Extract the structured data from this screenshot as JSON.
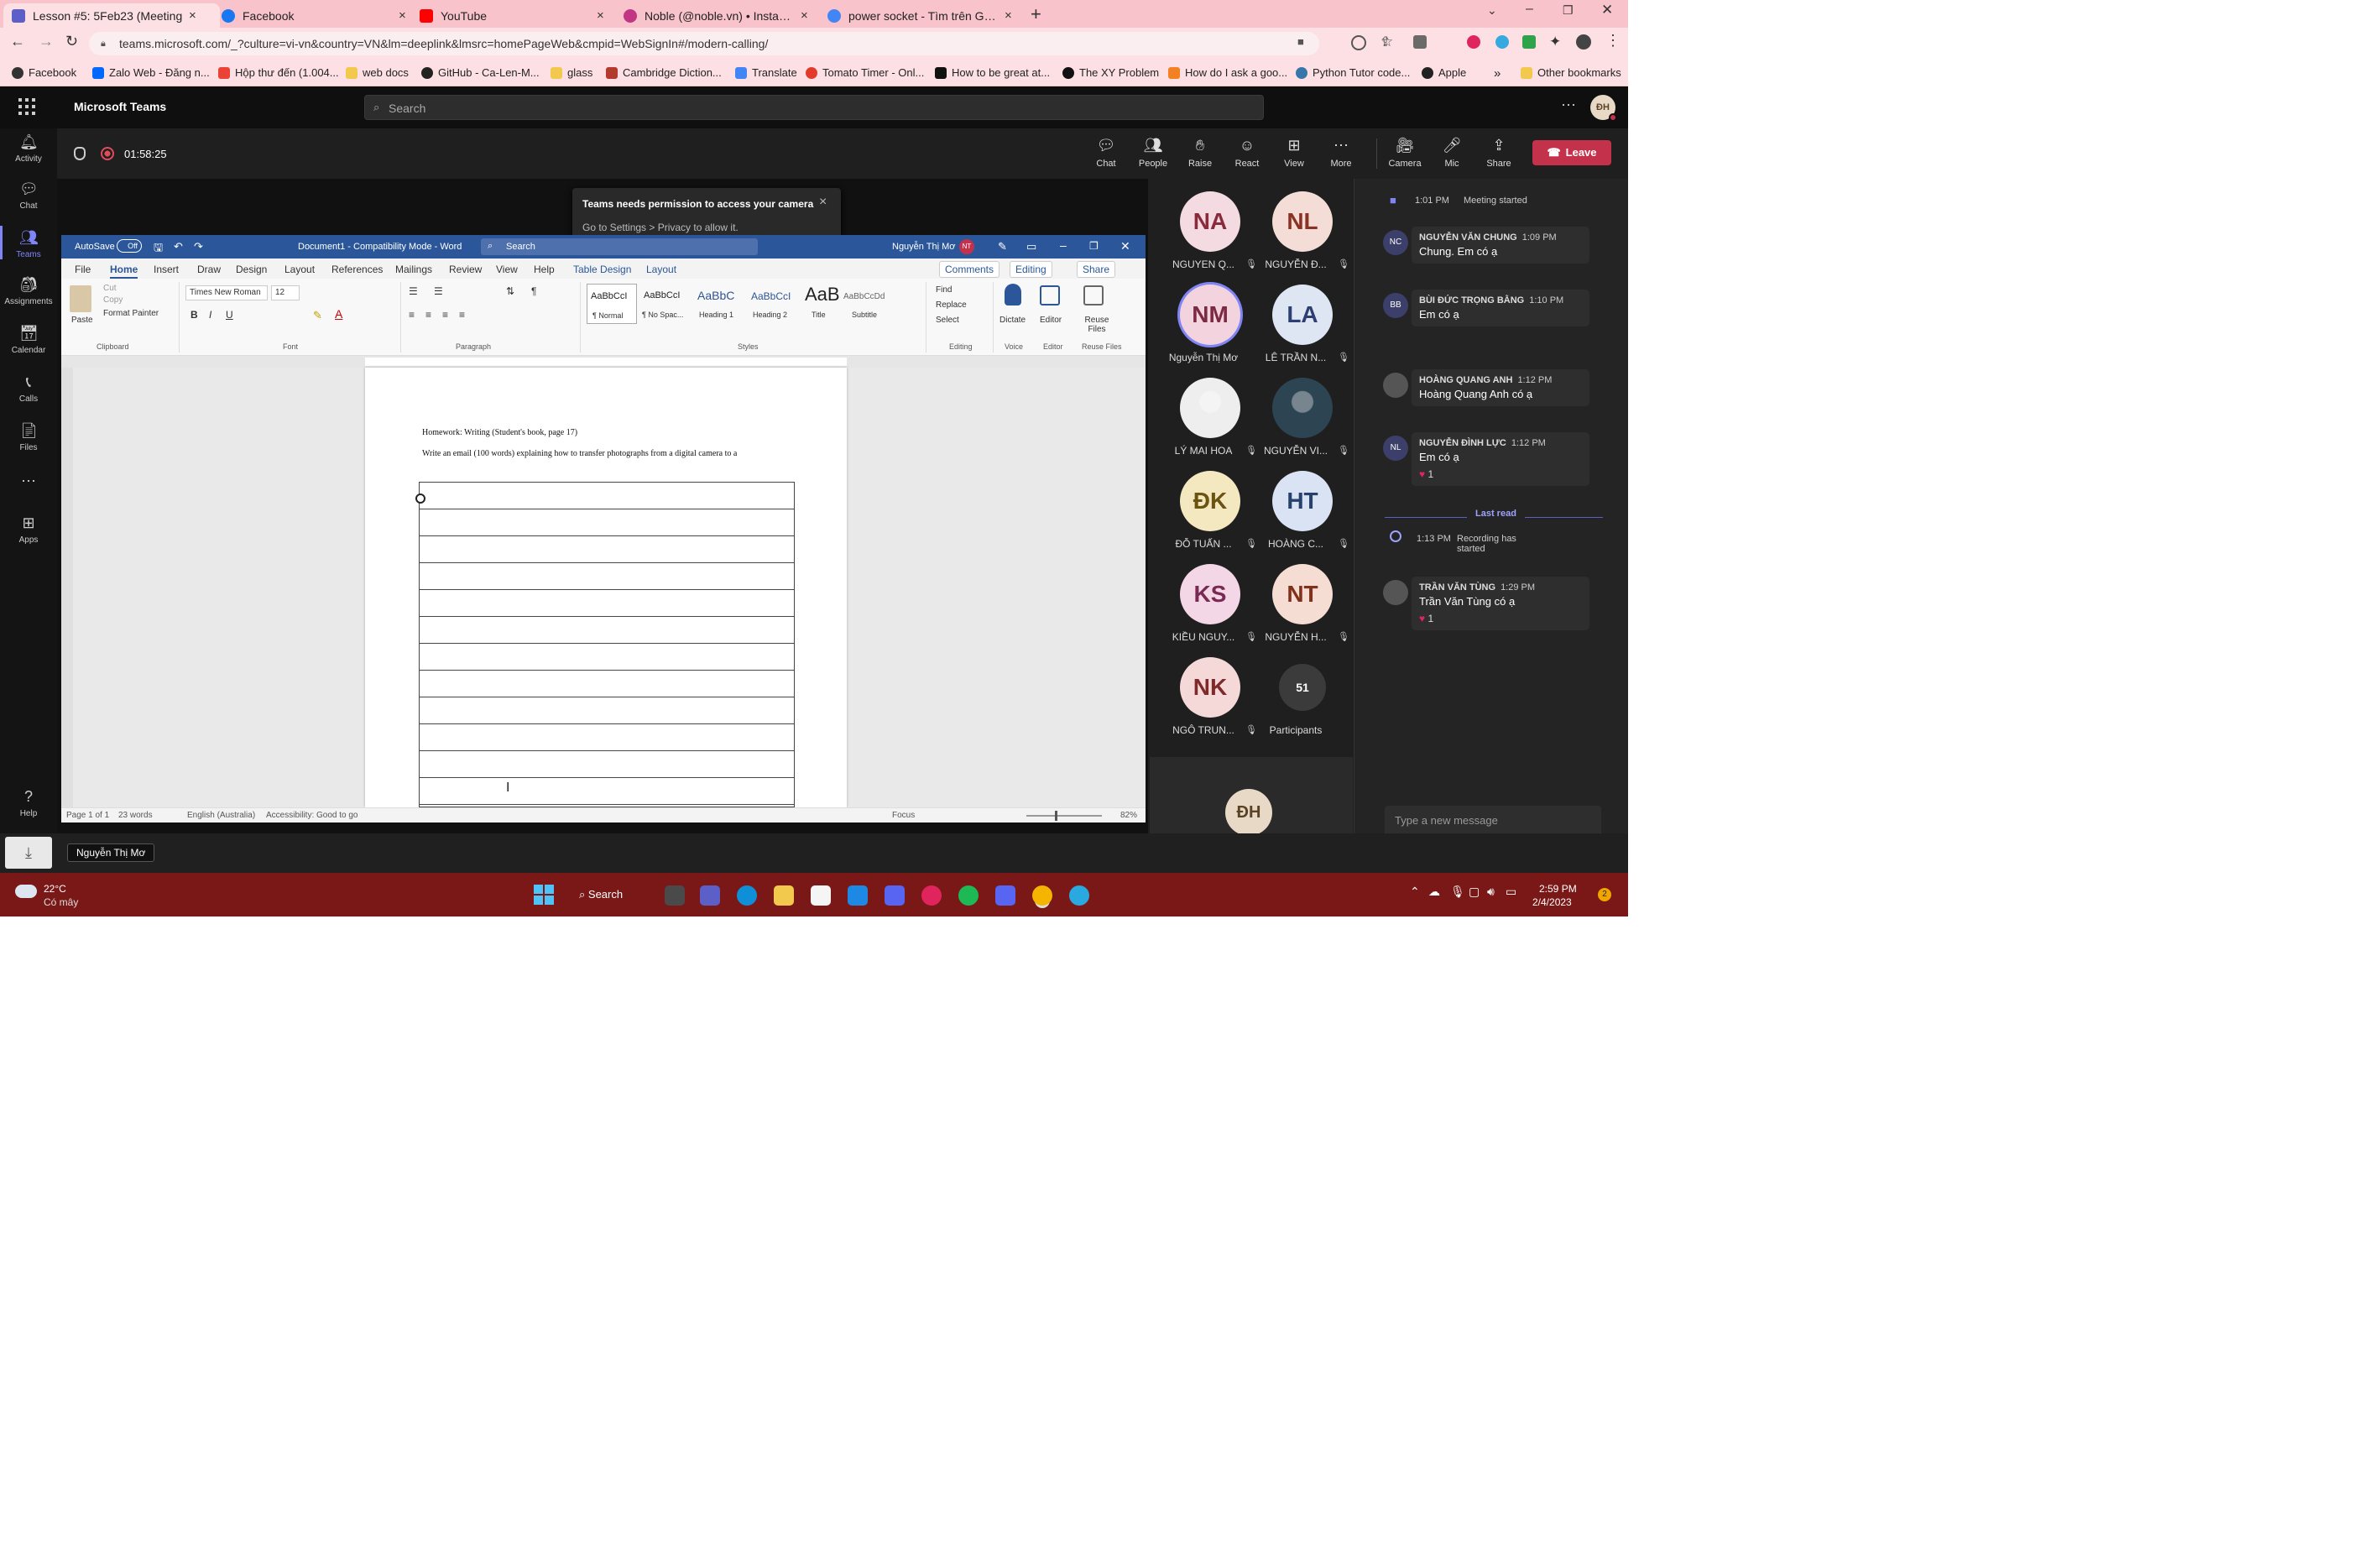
{
  "browser": {
    "tabs": [
      {
        "title": "Lesson #5: 5Feb23 (Meeting",
        "active": true,
        "color": "#5b5fc7"
      },
      {
        "title": "Facebook",
        "active": false,
        "color": "#1877f2"
      },
      {
        "title": "YouTube",
        "active": false,
        "color": "#ff0000"
      },
      {
        "title": "Noble (@noble.vn) • Instagram p",
        "active": false,
        "color": "#c13584"
      },
      {
        "title": "power socket - Tìm trên Google",
        "active": false,
        "color": "#4285f4"
      }
    ],
    "new_tab": "+",
    "url": "teams.microsoft.com/_?culture=vi-vn&country=VN&lm=deeplink&lmsrc=homePageWeb&cmpid=WebSignIn#/modern-calling/",
    "bookmarks": [
      "Facebook",
      "Zalo Web - Đăng n...",
      "Hộp thư đến (1.004...",
      "web docs",
      "GitHub - Ca-Len-M...",
      "glass",
      "Cambridge Diction...",
      "Translate",
      "Tomato Timer - Onl...",
      "How to be great at...",
      "The XY Problem",
      "How do I ask a goo...",
      "Python Tutor code...",
      "Apple"
    ],
    "more_bookmarks": "»",
    "other_bookmarks": "Other bookmarks"
  },
  "teams": {
    "app_name": "Microsoft Teams",
    "search_placeholder": "Search",
    "user_initials": "ĐH",
    "rail": [
      "Activity",
      "Chat",
      "Teams",
      "Assignments",
      "Calendar",
      "Calls",
      "Files",
      "Apps",
      "Help"
    ],
    "meeting_timer": "01:58:25",
    "controls": [
      "Chat",
      "People",
      "Raise",
      "React",
      "View",
      "More",
      "Camera",
      "Mic",
      "Share"
    ],
    "leave_label": "Leave",
    "toast": {
      "title": "Teams needs permission to access your camera",
      "body": "Go to Settings > Privacy to allow it."
    }
  },
  "word": {
    "autosave": "AutoSave",
    "autosave_state": "Off",
    "doc_title": "Document1  -  Compatibility Mode  -  Word",
    "search": "Search",
    "user": "Nguyễn Thị Mơ",
    "user_initials": "NT",
    "tabs": [
      "File",
      "Home",
      "Insert",
      "Draw",
      "Design",
      "Layout",
      "References",
      "Mailings",
      "Review",
      "View",
      "Help",
      "Table Design",
      "Layout"
    ],
    "comments": "Comments",
    "editing": "Editing",
    "share": "Share",
    "font_name": "Times New Roman",
    "font_size": "12",
    "clipboard": {
      "paste": "Paste",
      "cut": "Cut",
      "copy": "Copy",
      "format_painter": "Format Painter"
    },
    "groups": [
      "Clipboard",
      "Font",
      "Paragraph",
      "Styles",
      "Editing",
      "Voice",
      "Editor",
      "Reuse Files"
    ],
    "styles": [
      {
        "preview": "AaBbCcI",
        "name": "¶ Normal"
      },
      {
        "preview": "AaBbCcI",
        "name": "¶ No Spac..."
      },
      {
        "preview": "AaBbC",
        "name": "Heading 1"
      },
      {
        "preview": "AaBbCcI",
        "name": "Heading 2"
      },
      {
        "preview": "AaB",
        "name": "Title"
      },
      {
        "preview": "AaBbCcDd",
        "name": "Subtitle"
      }
    ],
    "editing_cmds": [
      "Find",
      "Replace",
      "Select"
    ],
    "dictate": "Dictate",
    "editor": "Editor",
    "reuse_files": "Reuse Files",
    "doc_line1": "Homework: Writing (Student's book, page 17)",
    "doc_line2": "Write an email (100 words) explaining how to transfer photographs from a digital camera to a",
    "status": {
      "page": "Page 1 of 1",
      "words": "23 words",
      "language": "English (Australia)",
      "accessibility": "Accessibility: Good to go",
      "focus": "Focus",
      "zoom": "82%"
    }
  },
  "participants": [
    {
      "initials": "NA",
      "name": "NGUYEN Q...",
      "bg": "#f3dbe1",
      "fg": "#8a2b3c",
      "muted": true
    },
    {
      "initials": "NL",
      "name": "NGUYỄN Đ...",
      "bg": "#f4dcd7",
      "fg": "#8a3325",
      "muted": true
    },
    {
      "initials": "NM",
      "name": "Nguyễn Thị Mơ",
      "bg": "#f3d3de",
      "fg": "#7b2a44",
      "muted": false,
      "speaking": true
    },
    {
      "initials": "LA",
      "name": "LÊ TRẦN N...",
      "bg": "#dfe6f3",
      "fg": "#2d3e70",
      "muted": true
    },
    {
      "initials": "",
      "name": "LÝ MAI HOA",
      "bg": "#eeeeee",
      "fg": "#333",
      "muted": true,
      "photo": true
    },
    {
      "initials": "",
      "name": "NGUYỄN VI...",
      "bg": "#2d4452",
      "fg": "#fff",
      "muted": true,
      "photo": true
    },
    {
      "initials": "ĐK",
      "name": "ĐỖ TUẤN ...",
      "bg": "#f4e8c1",
      "fg": "#6b5310",
      "muted": true
    },
    {
      "initials": "HT",
      "name": "HOÀNG C...",
      "bg": "#dae3f3",
      "fg": "#26416b",
      "muted": true
    },
    {
      "initials": "KS",
      "name": "KIỀU NGUY...",
      "bg": "#f3d7e6",
      "fg": "#7a2953",
      "muted": true
    },
    {
      "initials": "NT",
      "name": "NGUYỄN H...",
      "bg": "#f5ddd4",
      "fg": "#80311c",
      "muted": true
    },
    {
      "initials": "NK",
      "name": "NGÔ TRUN...",
      "bg": "#f5d9d9",
      "fg": "#7d2a2a",
      "muted": true
    },
    {
      "initials": "51",
      "name": "Participants",
      "bg": "#3b3b3b",
      "fg": "#fff",
      "muted": false
    }
  ],
  "self_view_initials": "ĐH",
  "chat": {
    "meeting_started_time": "1:01 PM",
    "meeting_started": "Meeting started",
    "messages": [
      {
        "initials": "NC",
        "author": "NGUYỄN VĂN CHUNG",
        "time": "1:09 PM",
        "text": "Chung. Em có ạ",
        "reaction": ""
      },
      {
        "initials": "BB",
        "author": "BÙI ĐỨC TRỌNG BẰNG",
        "time": "1:10 PM",
        "text": "Em có ạ",
        "reaction": ""
      },
      {
        "initials": "",
        "author": "HOÀNG QUANG ANH",
        "time": "1:12 PM",
        "text": "Hoàng Quang Anh có ạ",
        "reaction": ""
      },
      {
        "initials": "NL",
        "author": "NGUYỄN ĐÌNH LỰC",
        "time": "1:12 PM",
        "text": "Em có ạ",
        "reaction": "1"
      },
      {
        "initials": "",
        "author": "TRẦN VĂN TÙNG",
        "time": "1:29 PM",
        "text": "Trần Văn Tùng có ạ",
        "reaction": "1"
      }
    ],
    "last_read": "Last read",
    "recording_time": "1:13 PM",
    "recording_text": "Recording has started",
    "compose_placeholder": "Type a new message"
  },
  "download_tooltip": "Nguyễn Thị Mơ",
  "taskbar": {
    "temp": "22°C",
    "weather": "Có mây",
    "search": "Search",
    "time": "2:59 PM",
    "date": "2/4/2023",
    "notif": "2"
  },
  "colors": {
    "teams_accent": "#5b5fc7",
    "leave_red": "#c4314b",
    "word_blue": "#2b579a",
    "taskbar": "#7a1818"
  }
}
